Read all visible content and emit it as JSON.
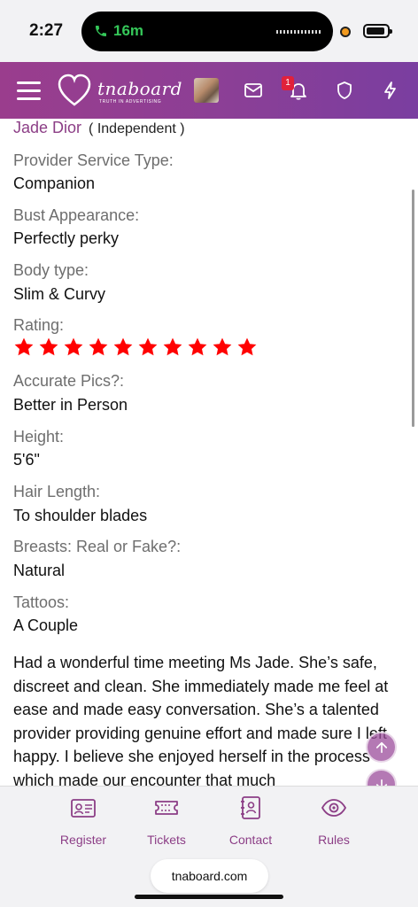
{
  "status_bar": {
    "time": "2:27",
    "call_duration": "16m"
  },
  "header": {
    "logo_name": "tnaboard",
    "logo_tagline": "TRUTH IN ADVERTISING",
    "notification_count": "1",
    "brand_color": "#8b3f96"
  },
  "provider": {
    "name": "Jade Dior",
    "type": "( Independent )"
  },
  "fields": [
    {
      "label": "Provider Service Type:",
      "value": "Companion"
    },
    {
      "label": "Bust Appearance:",
      "value": "Perfectly perky"
    },
    {
      "label": "Body type:",
      "value": "Slim & Curvy"
    },
    {
      "label": "Rating:",
      "stars": 10
    },
    {
      "label": "Accurate Pics?:",
      "value": "Better in Person"
    },
    {
      "label": "Height:",
      "value": "5'6\""
    },
    {
      "label": "Hair Length:",
      "value": "To shoulder blades"
    },
    {
      "label": "Breasts: Real or Fake?:",
      "value": "Natural"
    },
    {
      "label": "Tattoos:",
      "value": "A Couple"
    }
  ],
  "star_color": "#ff0000",
  "review_text": "Had a wonderful time meeting Ms Jade. She’s safe, discreet and clean. She immediately made me feel at ease and made easy conversation. She’s a talented provider providing genuine effort and made sure I left happy. I believe she enjoyed herself in the process which made our encounter that much",
  "bottom_nav": [
    {
      "label": "Register",
      "icon": "id-card-icon"
    },
    {
      "label": "Tickets",
      "icon": "ticket-icon"
    },
    {
      "label": "Contact",
      "icon": "contact-book-icon"
    },
    {
      "label": "Rules",
      "icon": "eye-icon"
    }
  ],
  "browser": {
    "url": "tnaboard.com"
  }
}
